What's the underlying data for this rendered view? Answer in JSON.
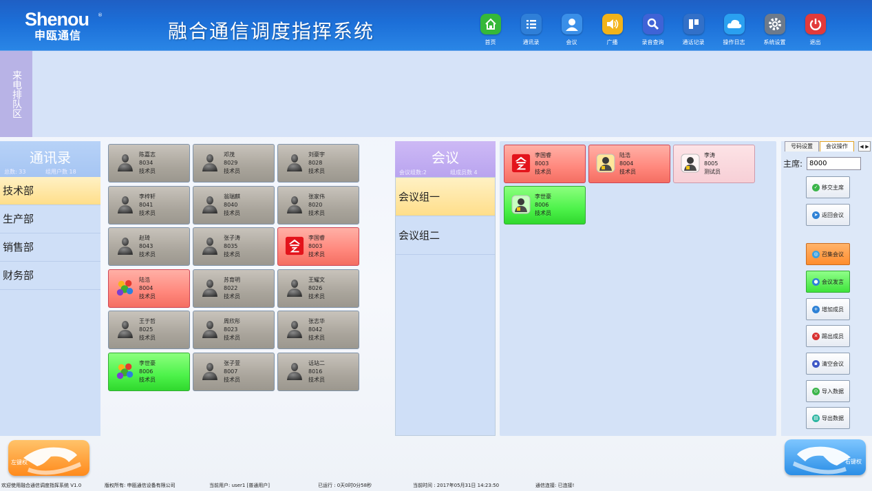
{
  "header": {
    "logo_en": "Shenou",
    "logo_cn": "申瓯通信",
    "logo_reg": "®",
    "title": "融合通信调度指挥系统",
    "nav": [
      {
        "label": "首页",
        "icon": "home-icon",
        "color": "#35b83a"
      },
      {
        "label": "通讯录",
        "icon": "list-icon",
        "color": "#2f7fd8"
      },
      {
        "label": "会议",
        "icon": "user-icon",
        "color": "#3a8fe8"
      },
      {
        "label": "广播",
        "icon": "speaker-icon",
        "color": "#f2b31a"
      },
      {
        "label": "录音查询",
        "icon": "search-icon",
        "color": "#3f63d6"
      },
      {
        "label": "通话记录",
        "icon": "record-icon",
        "color": "#3270c8"
      },
      {
        "label": "操作日志",
        "icon": "cloud-icon",
        "color": "#2aa0f0"
      },
      {
        "label": "系统设置",
        "icon": "gear-icon",
        "color": "#6d7a8b"
      },
      {
        "label": "退出",
        "icon": "power-icon",
        "color": "#e23a3a"
      }
    ]
  },
  "queue": {
    "label": "来电排队区"
  },
  "contacts": {
    "title": "通讯录",
    "total": "总数: 33",
    "group_count": "组用户数 18",
    "departments": [
      "技术部",
      "生产部",
      "销售部",
      "财务部"
    ],
    "active_department": 0,
    "cards": [
      {
        "name": "陈嘉志",
        "number": "8034",
        "role": "技术员",
        "state": "idle"
      },
      {
        "name": "邓茂",
        "number": "8029",
        "role": "技术员",
        "state": "idle"
      },
      {
        "name": "刘豪宇",
        "number": "8028",
        "role": "技术员",
        "state": "idle"
      },
      {
        "name": "李梓轩",
        "number": "8041",
        "role": "技术员",
        "state": "idle"
      },
      {
        "name": "翁瑞麒",
        "number": "8040",
        "role": "技术员",
        "state": "idle"
      },
      {
        "name": "张家伟",
        "number": "8020",
        "role": "技术员",
        "state": "idle"
      },
      {
        "name": "赵琦",
        "number": "8043",
        "role": "技术员",
        "state": "idle"
      },
      {
        "name": "张子涛",
        "number": "8035",
        "role": "技术员",
        "state": "idle"
      },
      {
        "name": "李国睿",
        "number": "8003",
        "role": "技术员",
        "state": "conference"
      },
      {
        "name": "陆浩",
        "number": "8004",
        "role": "技术员",
        "state": "busy"
      },
      {
        "name": "苏育明",
        "number": "8022",
        "role": "技术员",
        "state": "idle"
      },
      {
        "name": "王耀文",
        "number": "8026",
        "role": "技术员",
        "state": "idle"
      },
      {
        "name": "王于哲",
        "number": "8025",
        "role": "技术员",
        "state": "idle"
      },
      {
        "name": "周欣彤",
        "number": "8023",
        "role": "技术员",
        "state": "idle"
      },
      {
        "name": "张志华",
        "number": "8042",
        "role": "技术员",
        "state": "idle"
      },
      {
        "name": "李世豪",
        "number": "8006",
        "role": "技术员",
        "state": "online"
      },
      {
        "name": "张子萱",
        "number": "8007",
        "role": "技术员",
        "state": "idle"
      },
      {
        "name": "话站二",
        "number": "8016",
        "role": "技术员",
        "state": "idle"
      }
    ]
  },
  "conference": {
    "title": "会议",
    "group_count": "会议组数:2",
    "member_count": "组成员数 4",
    "groups": [
      "会议组一",
      "会议组二"
    ],
    "active_group": 0,
    "members": [
      {
        "name": "李国睿",
        "number": "8003",
        "role": "技术员",
        "state": "conference"
      },
      {
        "name": "陆浩",
        "number": "8004",
        "role": "技术员",
        "state": "busy"
      },
      {
        "name": "李涛",
        "number": "8005",
        "role": "测试员",
        "state": "pending"
      },
      {
        "name": "李世豪",
        "number": "8006",
        "role": "技术员",
        "state": "online"
      }
    ]
  },
  "right_panel": {
    "tabs": [
      "号码设置",
      "会议操作"
    ],
    "active_tab": 1,
    "chair_label": "主席:",
    "chair_value": "8000",
    "buttons": [
      {
        "label": "移交主席",
        "icon": "check-icon",
        "color": "#3bb54a",
        "style": "normal"
      },
      {
        "label": "返回会议",
        "icon": "send-icon",
        "color": "#2f82d6",
        "style": "normal"
      },
      {
        "label": "召集会议",
        "icon": "convene-icon",
        "color": "#3aa0e0",
        "style": "orange"
      },
      {
        "label": "会议发言",
        "icon": "speak-icon",
        "color": "#2f82d6",
        "style": "green"
      },
      {
        "label": "增加成员",
        "icon": "plus-icon",
        "color": "#2f82d6",
        "style": "normal"
      },
      {
        "label": "踢出成员",
        "icon": "close-icon",
        "color": "#d83030",
        "style": "normal"
      },
      {
        "label": "清空会议",
        "icon": "trash-icon",
        "color": "#3e58c6",
        "style": "normal"
      },
      {
        "label": "导入数据",
        "icon": "import-icon",
        "color": "#3bb54a",
        "style": "normal"
      },
      {
        "label": "导出数据",
        "icon": "export-icon",
        "color": "#2bb5a0",
        "style": "normal"
      }
    ]
  },
  "phone": {
    "left_label": "左键权",
    "right_label": "右键权"
  },
  "status": {
    "welcome": "欢迎使用融合通信调度指挥系统 V1.0",
    "copyright": "版权所有: 申瓯通信设备有限公司",
    "user": "当前用户: user1 [普通用户]",
    "uptime": "已运行 : 0天0时0分58秒",
    "time": "当前时间 : 2017年05月31日 14:23:50",
    "link": "通信连接: 已连接!"
  }
}
